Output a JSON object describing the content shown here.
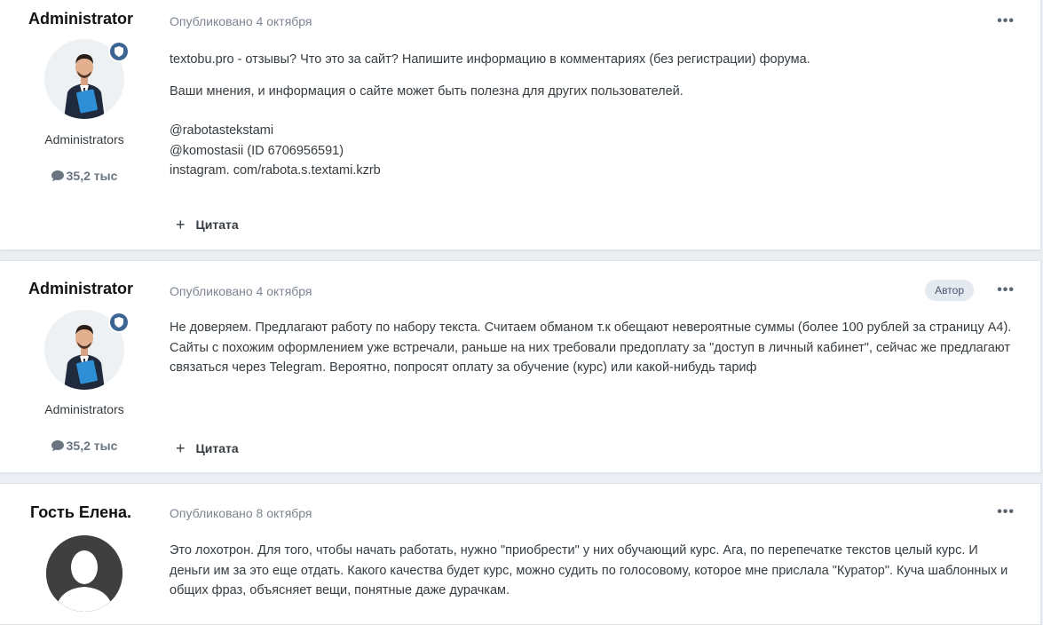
{
  "posts": [
    {
      "author": "Administrator",
      "group": "Administrators",
      "post_count": "35,2 тыс",
      "published": "Опубликовано 4 октября",
      "more": "•••",
      "badge": "",
      "paragraphs": [
        "textobu.pro - отзывы? Что это за сайт? Напишите информацию в комментариях (без регистрации) форума.",
        "Ваши мнения, и информация о сайте может быть полезна для других пользователей."
      ],
      "contacts": [
        "@rabotastekstami",
        "@komostasii (ID 6706956591)",
        "instagram. com/rabota.s.textami.kzrb"
      ],
      "quote_label": "Цитата"
    },
    {
      "author": "Administrator",
      "group": "Administrators",
      "post_count": "35,2 тыс",
      "published": "Опубликовано 4 октября",
      "more": "•••",
      "badge": "Автор",
      "paragraphs": [
        "Не доверяем. Предлагают работу по набору текста. Считаем обманом т.к обещают невероятные суммы (более 100 рублей за страницу А4). Сайты с похожим оформлением уже встречали, раньше на них требовали предоплату за \"доступ в личный кабинет\", сейчас же предлагают связаться через Telegram. Вероятно, попросят оплату за обучение (курс) или какой-нибудь тариф"
      ],
      "quote_label": "Цитата"
    },
    {
      "author": "Гость Елена.",
      "published": "Опубликовано 8 октября",
      "more": "•••",
      "paragraphs": [
        "Это лохотрон. Для того, чтобы начать работать, нужно \"приобрести\" у них обучающий курс. Ага, по перепечатке текстов целый курс. И деньги им за это еще отдать. Какого качества будет курс, можно судить по голосовому, которое мне прислала \"Куратор\". Куча шаблонных и общих фраз, объясняет вещи, понятные даже дурачкам."
      ]
    }
  ],
  "colors": {
    "page_bg": "#ebeef2",
    "badge_blue": "#3d6594",
    "meta_gray": "#7d8591"
  }
}
